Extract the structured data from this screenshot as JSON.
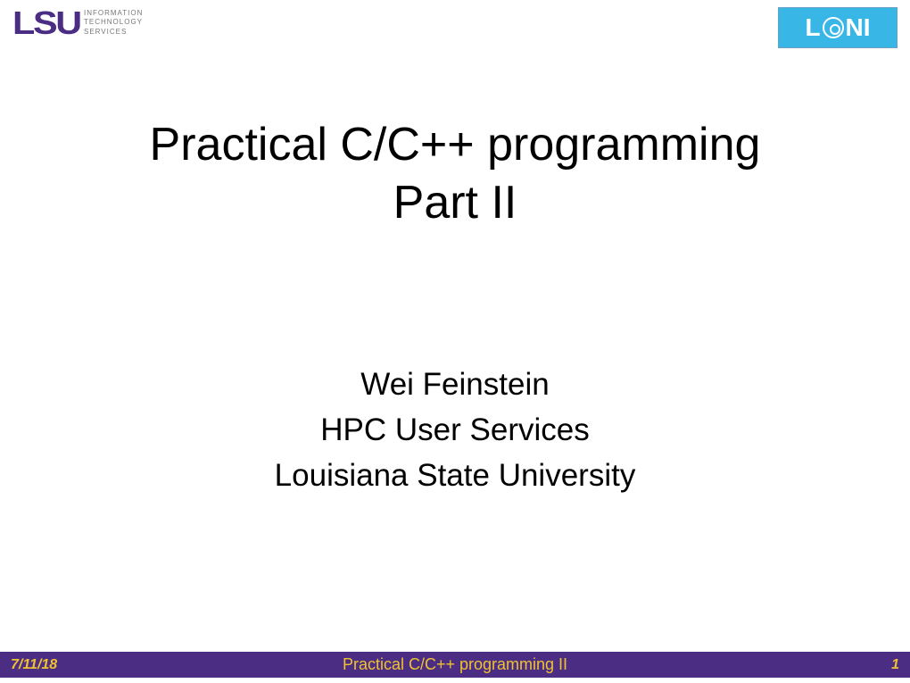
{
  "header": {
    "lsu_mark": "LSU",
    "its_line1": "INFORMATION",
    "its_line2": "TECHNOLOGY",
    "its_line3": "SERVICES",
    "loni_text_L": "L",
    "loni_text_NI": "NI"
  },
  "title": {
    "line1": "Practical C/C++ programming",
    "line2": "Part II"
  },
  "authors": {
    "name": "Wei Feinstein",
    "dept": "HPC User Services",
    "org": "Louisiana State University"
  },
  "footer": {
    "date": "7/11/18",
    "center": "Practical C/C++ programming II",
    "page": "1"
  }
}
